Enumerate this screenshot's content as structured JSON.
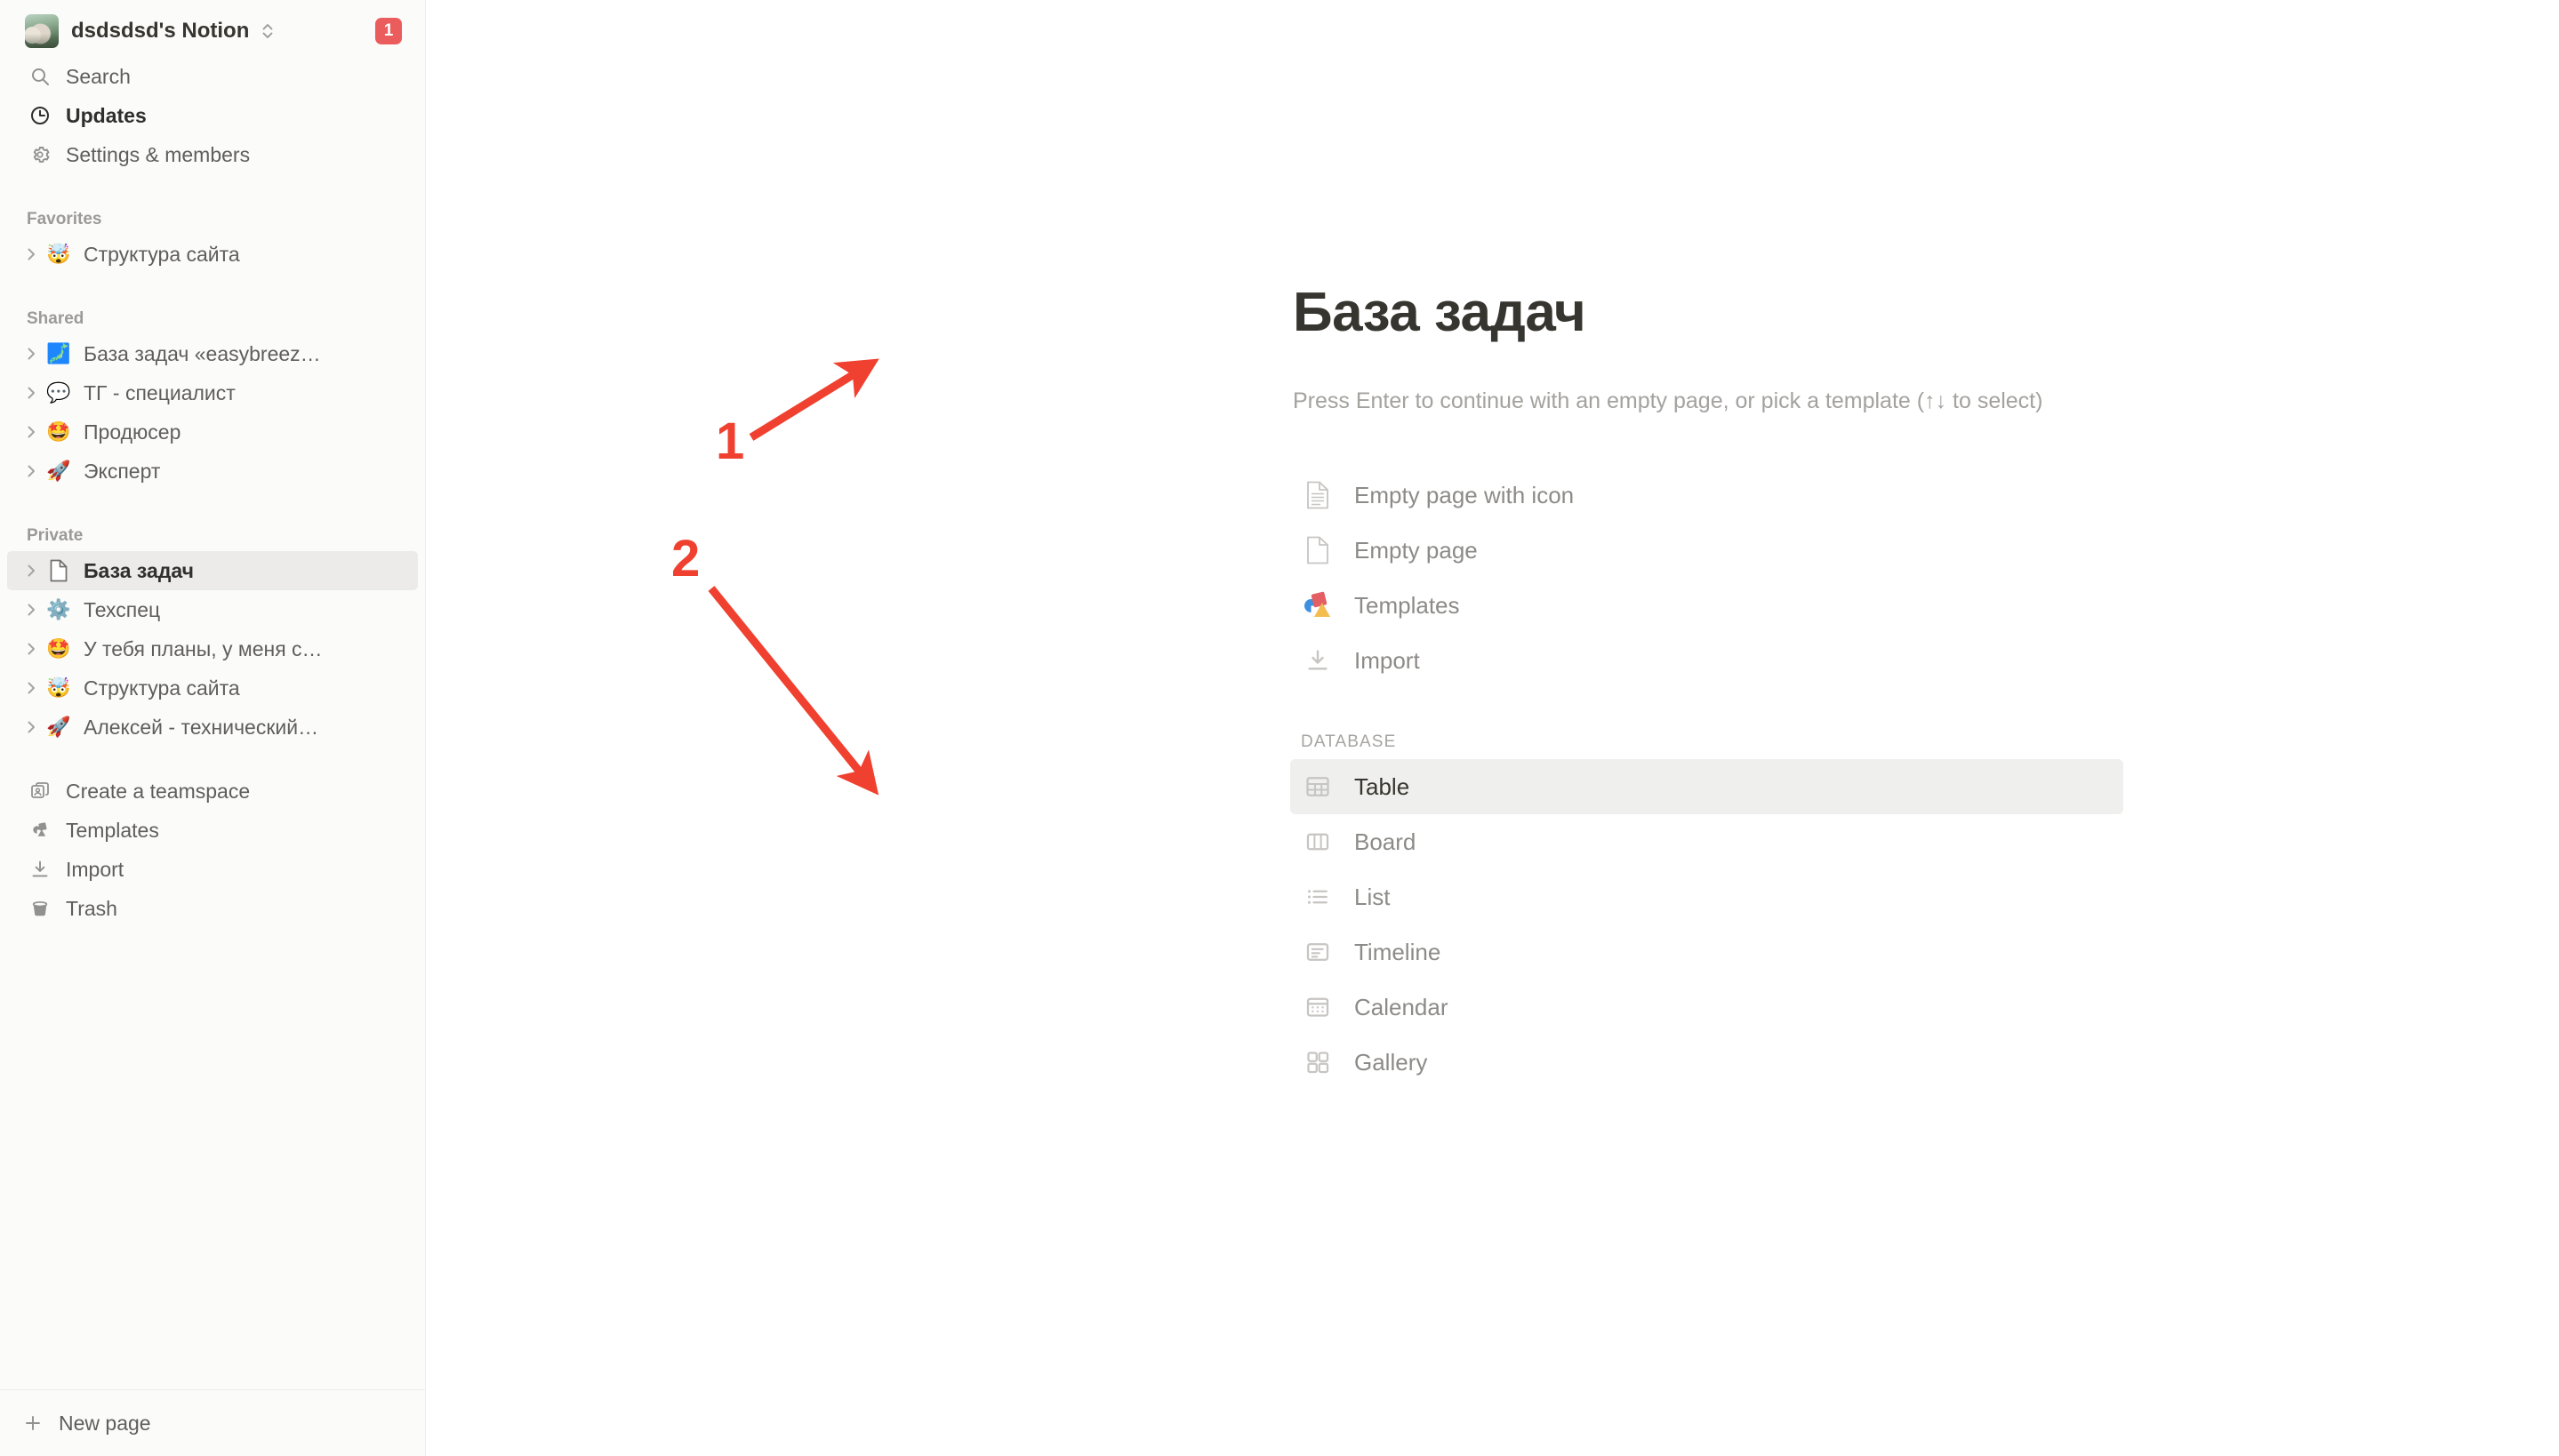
{
  "workspace": {
    "name": "dsdsdsd's Notion",
    "avatar_icon": "workspace-photo-avatar",
    "switcher_icon": "chevron-up-down-icon",
    "badge_count": "1",
    "badge_color": "#eb5c5c"
  },
  "sidebar": {
    "top_items": [
      {
        "label": "Search",
        "icon": "search-icon",
        "emphasis": false
      },
      {
        "label": "Updates",
        "icon": "clock-icon",
        "emphasis": true
      },
      {
        "label": "Settings & members",
        "icon": "gear-icon",
        "emphasis": false
      }
    ],
    "sections": [
      {
        "title": "Favorites",
        "items": [
          {
            "label": "Структура сайта",
            "emoji": "🤯",
            "selected": false
          }
        ]
      },
      {
        "title": "Shared",
        "items": [
          {
            "label": "База задач «easybreez…",
            "emoji": "🗾",
            "selected": false
          },
          {
            "label": "ТГ - специалист",
            "emoji": "💬",
            "selected": false
          },
          {
            "label": "Продюсер",
            "emoji": "🤩",
            "selected": false
          },
          {
            "label": "Эксперт",
            "emoji": "🚀",
            "selected": false
          }
        ]
      },
      {
        "title": "Private",
        "items": [
          {
            "label": "База задач",
            "emoji": "📄",
            "selected": true
          },
          {
            "label": "Техспец",
            "emoji": "⚙️",
            "selected": false
          },
          {
            "label": "У тебя планы, у меня с…",
            "emoji": "🤩",
            "selected": false
          },
          {
            "label": "Структура сайта",
            "emoji": "🤯",
            "selected": false
          },
          {
            "label": "Алексей - технический…",
            "emoji": "🚀",
            "selected": false
          }
        ]
      }
    ],
    "footer_items": [
      {
        "label": "Create a teamspace",
        "icon": "teamspace-icon"
      },
      {
        "label": "Templates",
        "icon": "templates-icon"
      },
      {
        "label": "Import",
        "icon": "import-icon"
      },
      {
        "label": "Trash",
        "icon": "trash-icon"
      }
    ],
    "new_page": {
      "label": "New page",
      "icon": "plus-icon"
    }
  },
  "main": {
    "title": "База задач",
    "hint": "Press Enter to continue with an empty page, or pick a template (↑↓ to select)",
    "options": [
      {
        "label": "Empty page with icon",
        "icon": "page-with-lines-icon",
        "highlight": false
      },
      {
        "label": "Empty page",
        "icon": "blank-page-icon",
        "highlight": false
      },
      {
        "label": "Templates",
        "icon": "templates-color-icon",
        "highlight": false
      },
      {
        "label": "Import",
        "icon": "import-icon",
        "highlight": false
      }
    ],
    "database_section": {
      "title": "DATABASE",
      "options": [
        {
          "label": "Table",
          "icon": "table-icon",
          "highlight": true
        },
        {
          "label": "Board",
          "icon": "board-icon",
          "highlight": false
        },
        {
          "label": "List",
          "icon": "list-icon",
          "highlight": false
        },
        {
          "label": "Timeline",
          "icon": "timeline-icon",
          "highlight": false
        },
        {
          "label": "Calendar",
          "icon": "calendar-icon",
          "highlight": false
        },
        {
          "label": "Gallery",
          "icon": "gallery-icon",
          "highlight": false
        }
      ]
    }
  },
  "annotations": {
    "color": "#f04030",
    "markers": [
      {
        "number": "1",
        "target": "page-title"
      },
      {
        "number": "2",
        "target": "table-option"
      }
    ]
  }
}
